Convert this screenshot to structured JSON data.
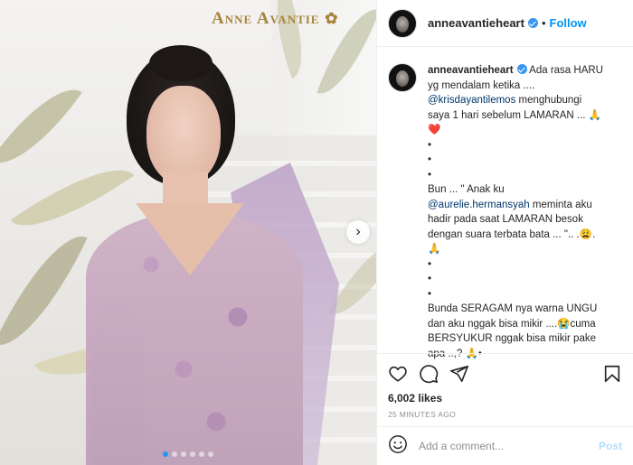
{
  "post": {
    "watermark_text": "Anne Avantie",
    "carousel": {
      "next_glyph": "›",
      "total_slides": 6,
      "active_index": 0
    }
  },
  "header": {
    "username": "anneavantieheart",
    "separator": "•",
    "follow_label": "Follow"
  },
  "caption": {
    "username": "anneavantieheart",
    "lines": [
      "Ada rasa HARU",
      "yg mendalam ketika ....",
      "@krisdayantilemos",
      "menghubungi",
      "saya 1 hari sebelum LAMARAN ... 🙏",
      "❤️",
      "•",
      "•",
      "•",
      "Bun ... \" Anak ku",
      "@aurelie.hermansyah",
      "meminta aku",
      "hadir pada saat LAMARAN besok",
      "dengan suara terbata bata ... \".. .😩.",
      "🙏",
      "•",
      "•",
      "•",
      "Bunda SERAGAM nya warna UNGU",
      "dan aku nggak bisa mikir ....😭cuma",
      "BERSYUKUR nggak bisa mikir pake",
      "apa ..,? 🙏•"
    ]
  },
  "stats": {
    "likes": "6,002 likes",
    "timestamp": "25 minutes ago"
  },
  "comment": {
    "placeholder": "Add a comment...",
    "post_label": "Post"
  },
  "icons": {
    "like": "heart-icon",
    "comment": "comment-icon",
    "share": "share-icon",
    "save": "bookmark-icon",
    "emoji": "emoji-icon",
    "verified": "verified-badge-icon"
  },
  "colors": {
    "link_blue": "#0095f6",
    "verified_blue": "#3897f0",
    "mention": "#00376b",
    "post_disabled": "#b2dffc",
    "watermark_gold": "#a8843e"
  }
}
